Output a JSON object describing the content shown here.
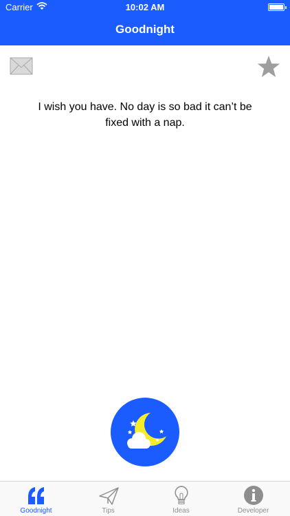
{
  "status_bar": {
    "carrier": "Carrier",
    "time": "10:02 AM"
  },
  "nav": {
    "title": "Goodnight"
  },
  "toolbar": {
    "mail_icon": "envelope-icon",
    "favorite_icon": "star-icon"
  },
  "content": {
    "quote": "I wish you have. No day is so bad it can’t be fixed with a nap."
  },
  "moon_button": {
    "icon": "moon-cloud-stars-icon"
  },
  "tabs": [
    {
      "label": "Goodnight",
      "icon": "quote-icon",
      "active": true
    },
    {
      "label": "Tips",
      "icon": "paper-plane-icon",
      "active": false
    },
    {
      "label": "Ideas",
      "icon": "lightbulb-icon",
      "active": false
    },
    {
      "label": "Developer",
      "icon": "info-icon",
      "active": false
    }
  ],
  "colors": {
    "accent": "#1a5cff",
    "moon": "#f5ec2b",
    "inactive": "#8e8e8e"
  }
}
